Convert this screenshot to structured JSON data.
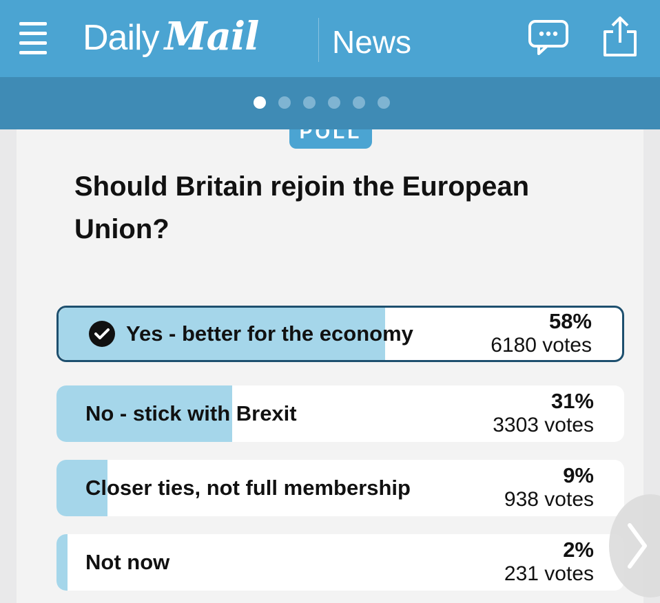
{
  "header": {
    "brand_daily": "Daily",
    "brand_mail": "Mail",
    "section": "News"
  },
  "carousel": {
    "total_dots": 6,
    "active_index": 0
  },
  "poll": {
    "tag": "POLL",
    "question": "Should Britain rejoin the European Union?",
    "options": [
      {
        "label": "Yes - better for the economy",
        "percent": "58%",
        "votes": "6180 votes",
        "share": 0.58,
        "selected": true
      },
      {
        "label": "No - stick with Brexit",
        "percent": "31%",
        "votes": "3303 votes",
        "share": 0.31,
        "selected": false
      },
      {
        "label": "Closer ties, not full membership",
        "percent": "9%",
        "votes": "938 votes",
        "share": 0.09,
        "selected": false
      },
      {
        "label": "Not now",
        "percent": "2%",
        "votes": "231 votes",
        "share": 0.02,
        "selected": false
      }
    ]
  },
  "colors": {
    "header_bg": "#4ba4d2",
    "dots_bar_bg": "#3f8bb5",
    "result_fill": "#a5d6ea",
    "selected_border": "#1d4f6e"
  },
  "icons": [
    "menu-icon",
    "chat-icon",
    "share-icon",
    "checkmark-icon",
    "chevron-right-icon"
  ]
}
